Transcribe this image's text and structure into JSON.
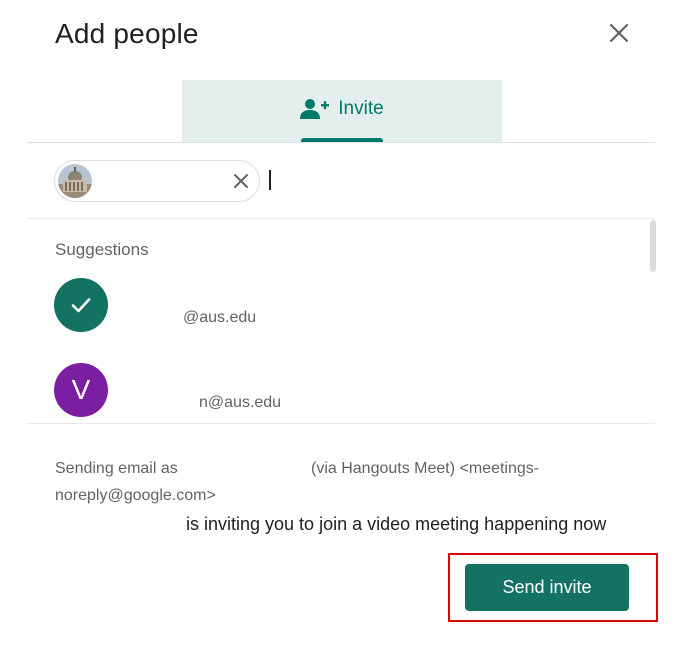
{
  "dialog": {
    "title": "Add people"
  },
  "tabs": [
    {
      "label": "Invite",
      "icon": "person-add-icon",
      "active": true
    }
  ],
  "recipient_chip": {
    "avatar": "building-photo-avatar"
  },
  "suggestions": {
    "label": "Suggestions",
    "items": [
      {
        "email": "@aus.edu",
        "avatar": "check",
        "selected": true
      },
      {
        "email": "n@aus.edu",
        "avatar_initial": "V",
        "selected": false
      }
    ]
  },
  "footer": {
    "sending_prefix": "Sending email as",
    "sending_via": "(via Hangouts Meet) <meetings-",
    "sending_line2": "noreply@google.com>",
    "invite_message": "is inviting you to join a video meeting happening now",
    "send_button": "Send invite"
  },
  "colors": {
    "accent": "#00796b",
    "button": "#137262",
    "tab_background": "#e2efec",
    "avatar_purple": "#7b1fa2",
    "highlight": "#e00000"
  }
}
